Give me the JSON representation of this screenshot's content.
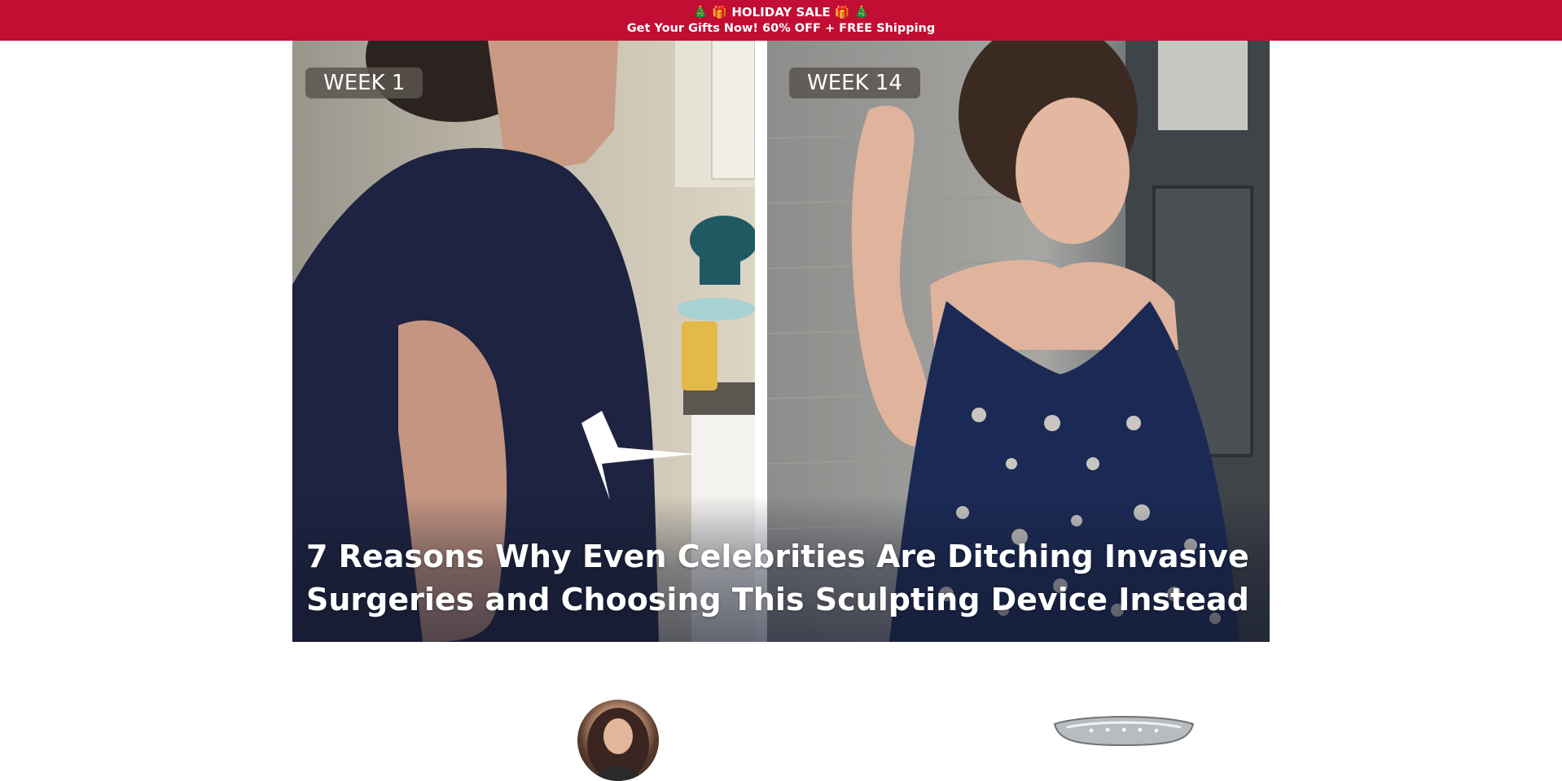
{
  "banner": {
    "line1_icons_left": "🎄 🎁",
    "line1_text": "HOLIDAY SALE",
    "line1_icons_right": "🎁 🎄",
    "line2_text": "Get Your Gifts Now! 60% OFF + FREE Shipping",
    "background_color": "#c20e33"
  },
  "hero": {
    "left_label": "WEEK 1",
    "right_label": "WEEK 14",
    "title": "7 Reasons Why Even Celebrities Are Ditching Invasive Surgeries and Choosing This Sculpting Device Instead",
    "arrow_icon": "arrow-left-icon"
  },
  "below_fold": {
    "avatar_icon": "author-avatar",
    "product_icon": "sculpting-device-image"
  }
}
